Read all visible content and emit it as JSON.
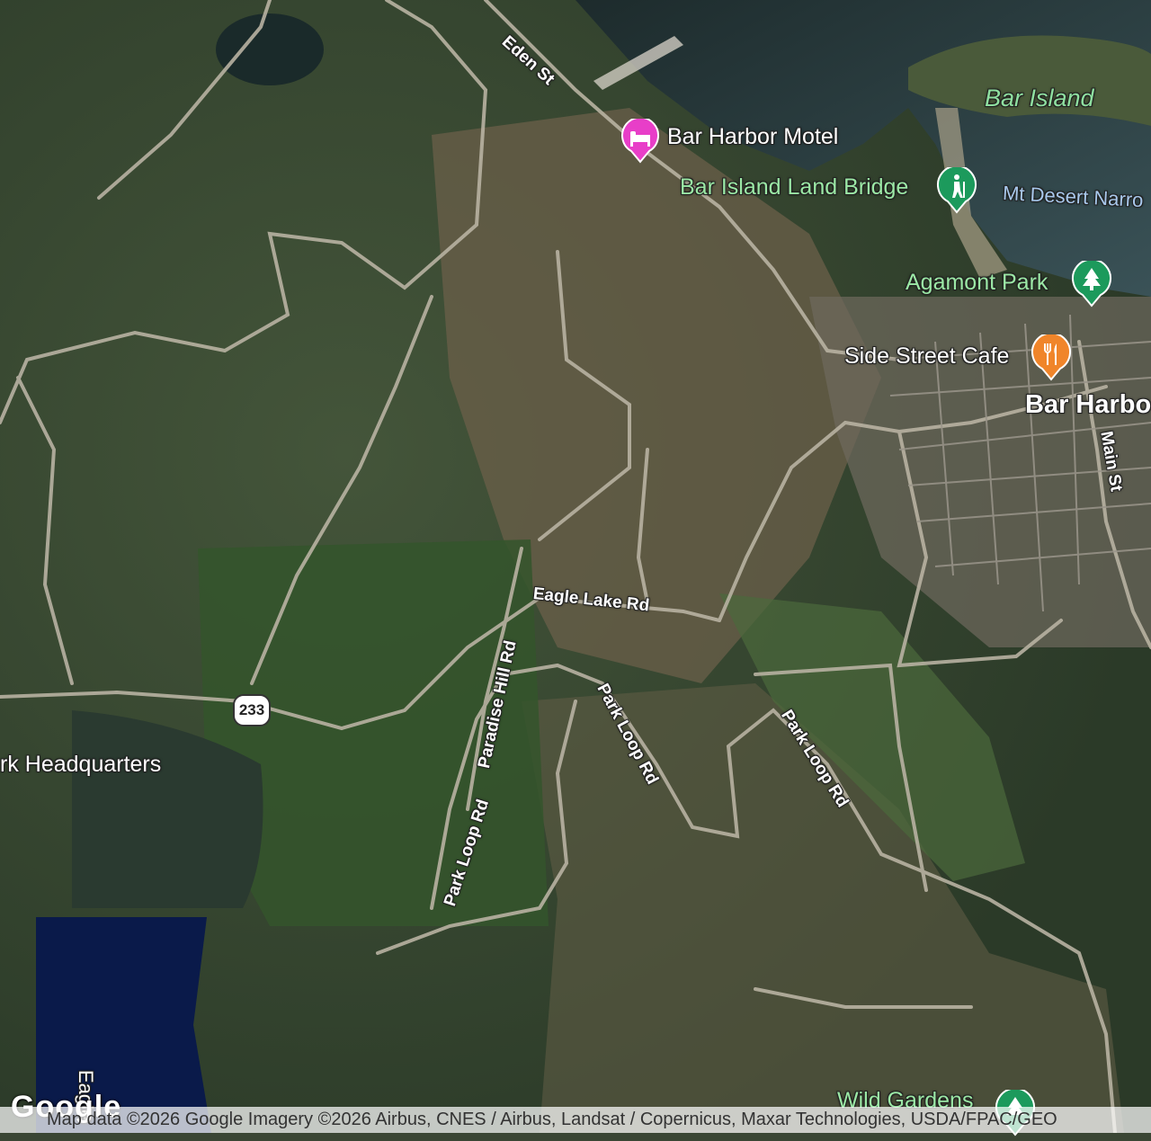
{
  "map": {
    "type": "satellite",
    "places": {
      "bar_harbor_motel": "Bar Harbor Motel",
      "bar_island": "Bar Island",
      "bar_island_land_bridge": "Bar Island Land Bridge",
      "mt_desert_narrows": "Mt Desert Narro",
      "agamont_park": "Agamont Park",
      "side_street_cafe": "Side Street Cafe",
      "bar_harbor": "Bar Harbo",
      "park_headquarters": "rk Headquarters",
      "wild_gardens": "Wild Gardens",
      "eagle": "Eagle"
    },
    "roads": {
      "eden_st": "Eden St",
      "main_st": "Main St",
      "eagle_lake_rd": "Eagle Lake Rd",
      "paradise_hill_rd": "Paradise Hill Rd",
      "park_loop_rd_1": "Park Loop Rd",
      "park_loop_rd_2": "Park Loop Rd",
      "park_loop_rd_3": "Park Loop Rd",
      "route_233": "233"
    },
    "icons": {
      "motel": "hotel-bed-icon",
      "land_bridge": "hiking-icon",
      "park": "tree-icon",
      "cafe": "restaurant-icon",
      "gardens": "tree-icon"
    },
    "colors": {
      "lodging_pin": "#e83ec8",
      "park_pin": "#1c9a5c",
      "food_pin": "#f0852a",
      "park_text": "#9be8a5"
    }
  },
  "footer": {
    "logo": "Google",
    "attribution": "Map data ©2026 Google Imagery ©2026 Airbus, CNES / Airbus, Landsat / Copernicus, Maxar Technologies, USDA/FPAC/GEO"
  }
}
